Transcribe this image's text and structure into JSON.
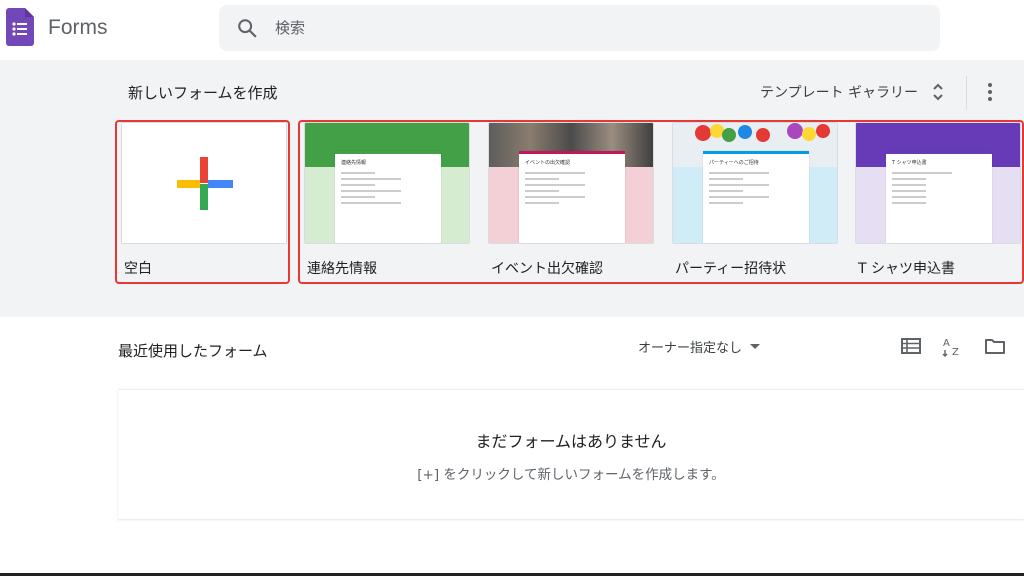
{
  "app": {
    "title": "Forms",
    "brand_color": "#7248b9"
  },
  "search": {
    "placeholder": "検索",
    "icon": "search-icon"
  },
  "gallery": {
    "heading": "新しいフォームを作成",
    "switch_label": "テンプレート ギャラリー",
    "templates": [
      {
        "label": "空白",
        "thumb": "blank-plus"
      },
      {
        "label": "連絡先情報",
        "thumb": "contact",
        "thumb_title": "連絡先情報",
        "accent": "#43a047",
        "bg": "#d6ecd0"
      },
      {
        "label": "イベント出欠確認",
        "thumb": "event",
        "thumb_title": "イベントの出欠確認",
        "accent": "#c2185b",
        "bg": "#f2d0d5"
      },
      {
        "label": "パーティー招待状",
        "thumb": "party",
        "thumb_title": "パーティーへのご招待",
        "accent": "#039be5",
        "bg": "#d0ecf6"
      },
      {
        "label": "T シャツ申込書",
        "thumb": "tshirt",
        "thumb_title": "T シャツ申込書",
        "accent": "#673ab7",
        "bg": "#e6dff3"
      }
    ]
  },
  "recent": {
    "heading": "最近使用したフォーム",
    "owner_filter": "オーナー指定なし",
    "empty_title": "まだフォームはありません",
    "empty_subtitle": "[+] をクリックして新しいフォームを作成します。"
  },
  "colors": {
    "gallery_bg": "#f1f3f4",
    "highlight": "#e53935"
  }
}
